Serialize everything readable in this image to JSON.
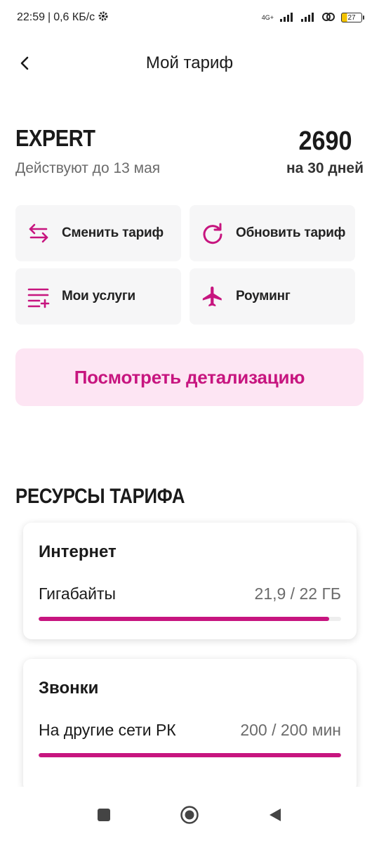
{
  "status_bar": {
    "time": "22:59",
    "speed": "0,6 КБ/с",
    "network": "4G+",
    "battery": "27"
  },
  "header": {
    "title": "Мой тариф"
  },
  "tariff": {
    "name": "EXPERT",
    "valid_until": "Действуют до 13 мая",
    "price": "2690",
    "period": "на 30 дней"
  },
  "actions": {
    "change": "Сменить тариф",
    "refresh": "Обновить тариф",
    "services": "Мои услуги",
    "roaming": "Роуминг"
  },
  "details_button": "Посмотреть детализацию",
  "resources": {
    "title": "РЕСУРСЫ ТАРИФА",
    "internet": {
      "title": "Интернет",
      "label": "Гигабайты",
      "value": "21,9 / 22 ГБ",
      "fill_percent": 96
    },
    "calls": {
      "title": "Звонки",
      "label": "На другие сети РК",
      "value": "200 / 200 мин",
      "fill_percent": 100
    }
  },
  "colors": {
    "accent": "#c7157f",
    "accent_light": "#fde5f3",
    "tile_bg": "#f6f6f7"
  }
}
